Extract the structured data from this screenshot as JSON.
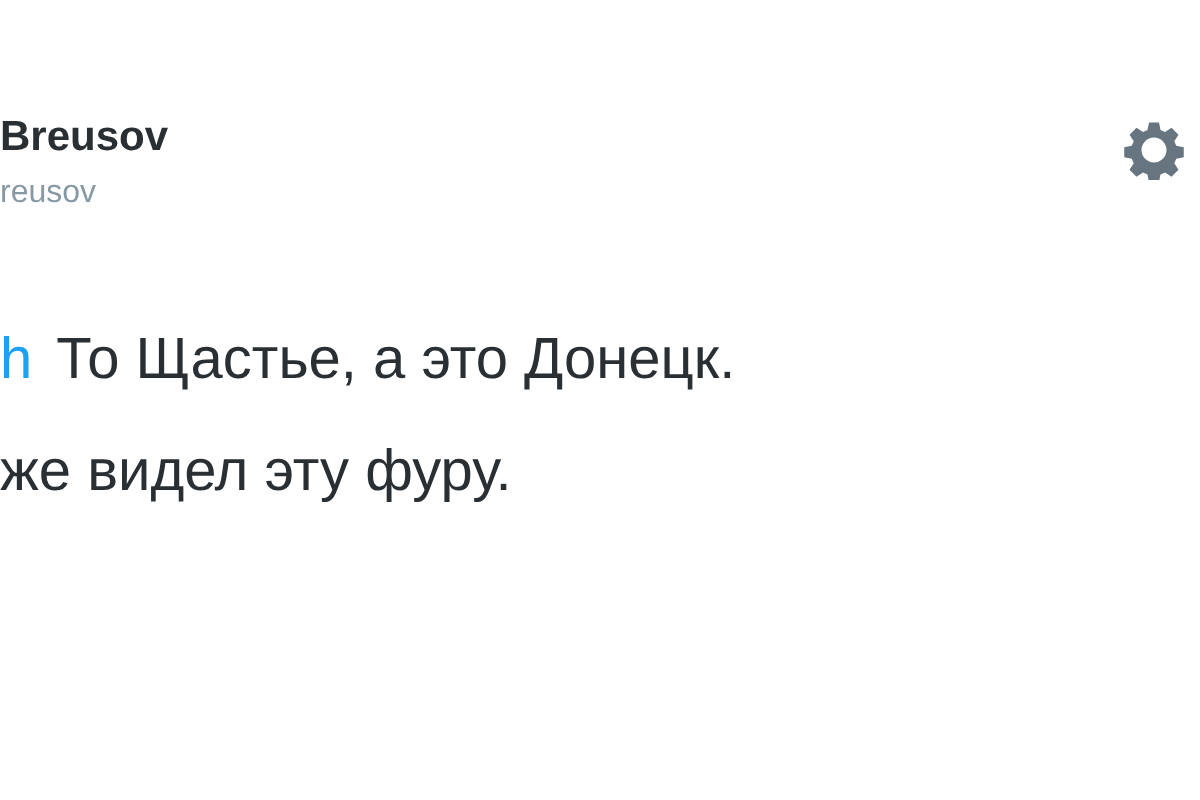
{
  "author": {
    "name": "Breusov",
    "handle": "reusov"
  },
  "tweet": {
    "mention": "h",
    "lines": [
      "То Щастье, а это Донецк.",
      "же видел эту фуру."
    ]
  }
}
